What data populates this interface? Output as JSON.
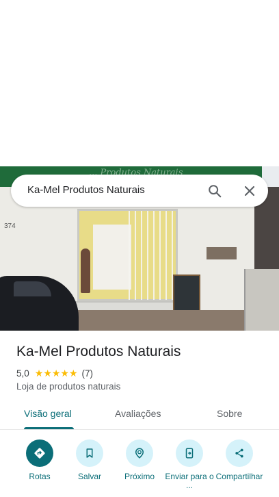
{
  "search": {
    "query": "Ka-Mel Produtos Naturais"
  },
  "photo": {
    "sign_text": "... Produtos Naturais",
    "house_number": "374"
  },
  "place": {
    "name": "Ka-Mel Produtos Naturais",
    "rating": "5,0",
    "stars": "★★★★★",
    "review_count": "(7)",
    "category": "Loja de produtos naturais"
  },
  "tabs": [
    {
      "label": "Visão geral",
      "active": true
    },
    {
      "label": "Avaliações",
      "active": false
    },
    {
      "label": "Sobre",
      "active": false
    }
  ],
  "actions": [
    {
      "label": "Rotas",
      "icon": "directions-icon"
    },
    {
      "label": "Salvar",
      "icon": "bookmark-icon"
    },
    {
      "label": "Próximo",
      "icon": "nearby-icon"
    },
    {
      "label": "Enviar para o ...",
      "icon": "send-to-phone-icon"
    },
    {
      "label": "Compartilhar",
      "icon": "share-icon"
    }
  ],
  "colors": {
    "accent": "#0b6e78",
    "action_bg": "#d5f2fa",
    "star": "#fbbc04"
  }
}
